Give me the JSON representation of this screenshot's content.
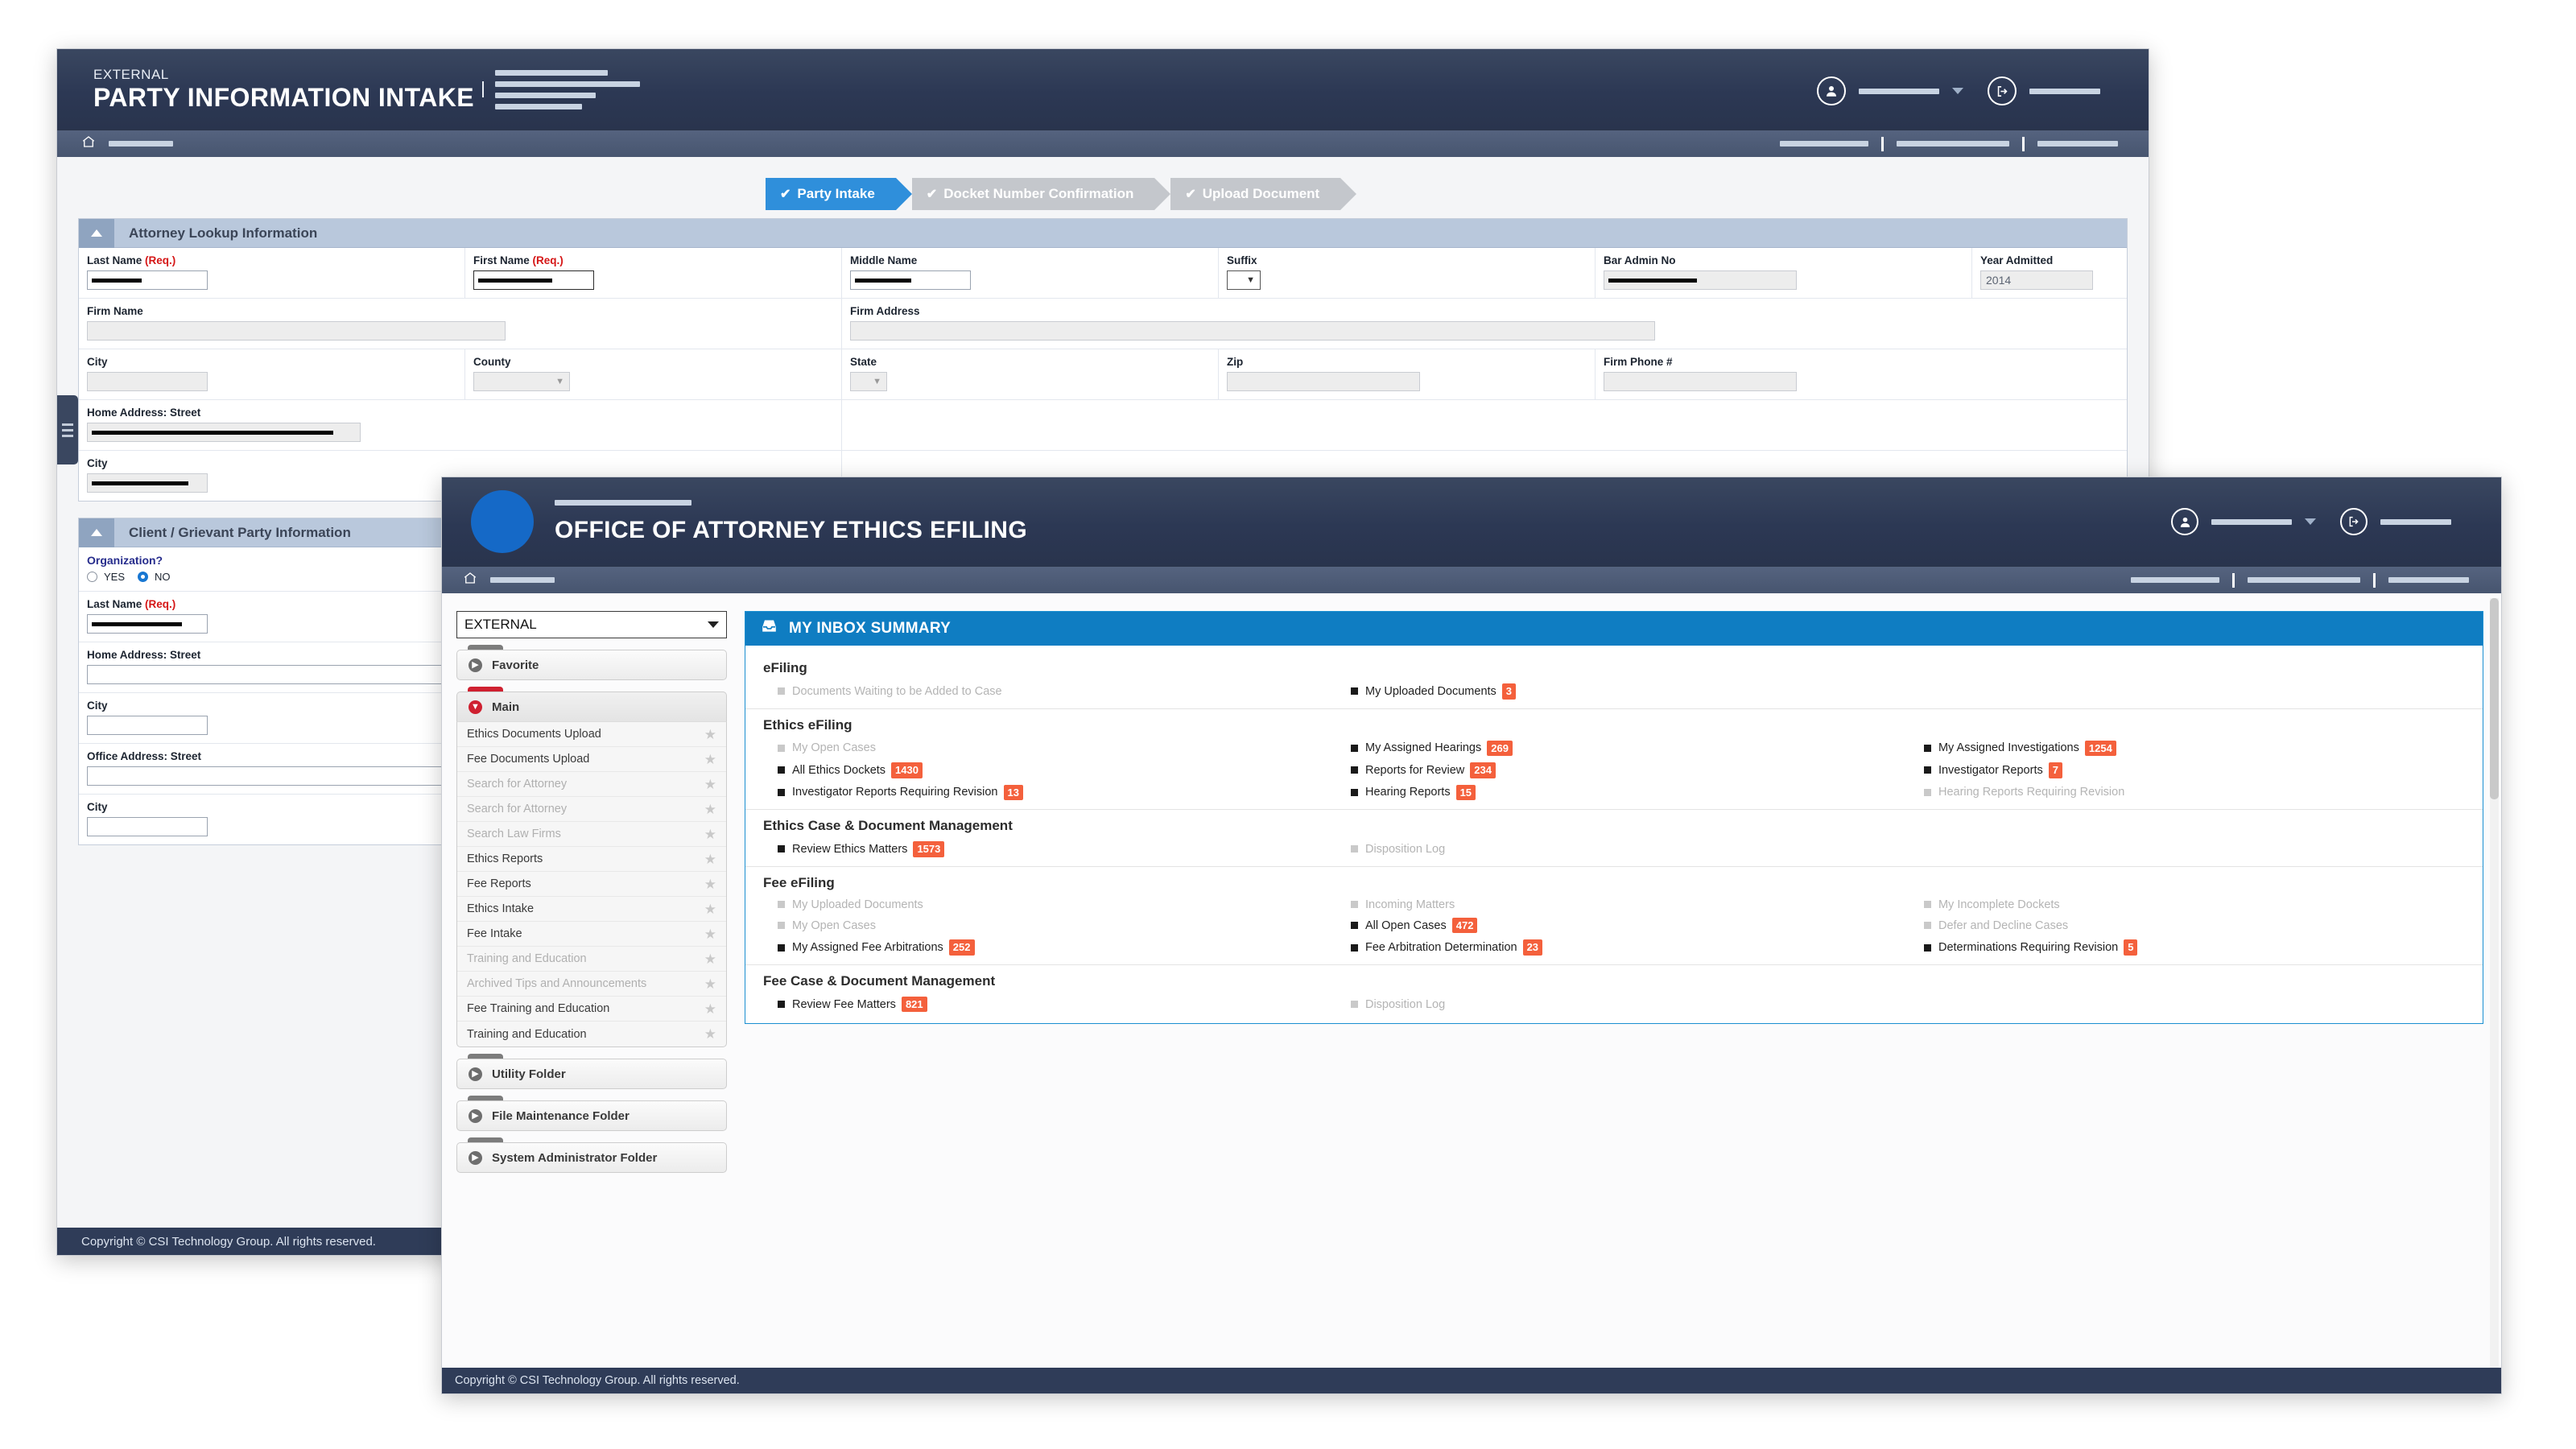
{
  "back_window": {
    "header": {
      "eyebrow": "EXTERNAL",
      "title": "PARTY INFORMATION INTAKE",
      "user_icon": "user-circle-icon",
      "logout_icon": "logout-icon"
    },
    "wizard": {
      "steps": [
        {
          "label": "Party Intake",
          "active": true,
          "check": "✔"
        },
        {
          "label": "Docket Number Confirmation",
          "active": false,
          "check": "✔"
        },
        {
          "label": "Upload Document",
          "active": false,
          "check": "✔"
        }
      ]
    },
    "panel_attorney": {
      "title": "Attorney Lookup Information",
      "fields": {
        "last_name": {
          "label": "Last Name",
          "req": "(Req.)",
          "value": "█████"
        },
        "first_name": {
          "label": "First Name",
          "req": "(Req.)",
          "value": "█████"
        },
        "middle_name": {
          "label": "Middle Name",
          "value": "████"
        },
        "suffix": {
          "label": "Suffix",
          "value": ""
        },
        "bar_admin_no": {
          "label": "Bar Admin No",
          "value": "████"
        },
        "year_admitted": {
          "label": "Year Admitted",
          "value": "2014"
        },
        "firm_name": {
          "label": "Firm Name",
          "value": ""
        },
        "firm_address": {
          "label": "Firm Address",
          "value": ""
        },
        "city": {
          "label": "City",
          "value": ""
        },
        "county": {
          "label": "County",
          "value": ""
        },
        "state": {
          "label": "State",
          "value": ""
        },
        "zip": {
          "label": "Zip",
          "value": ""
        },
        "firm_phone": {
          "label": "Firm Phone #",
          "value": ""
        },
        "home_street": {
          "label": "Home Address: Street",
          "value": "██████"
        },
        "home_city": {
          "label": "City",
          "value": "█████"
        }
      }
    },
    "panel_client": {
      "title": "Client / Grievant Party Information",
      "organization_question": "Organization?",
      "organization_options": [
        {
          "label": "YES",
          "selected": false
        },
        {
          "label": "NO",
          "selected": true
        }
      ],
      "fields": {
        "last_name": {
          "label": "Last Name",
          "req": "(Req.)",
          "value": "██████"
        },
        "home_street": {
          "label": "Home Address: Street",
          "value": ""
        },
        "home_city": {
          "label": "City",
          "value": ""
        },
        "office_street": {
          "label": "Office Address: Street",
          "value": ""
        },
        "office_city": {
          "label": "City",
          "value": ""
        }
      }
    },
    "footer": "Copyright © CSI Technology Group. All rights reserved."
  },
  "front_window": {
    "header": {
      "title": "OFFICE OF ATTORNEY ETHICS EFILING",
      "seal_icon": "agency-seal-icon",
      "user_icon": "user-circle-icon",
      "logout_icon": "logout-icon"
    },
    "sidebar": {
      "context_select": {
        "value": "EXTERNAL",
        "icon": "chevron-down-icon"
      },
      "folders": [
        {
          "title": "Favorite",
          "icon": "expand-circle-icon",
          "open": false,
          "accent": "gray",
          "items": []
        },
        {
          "title": "Main",
          "icon": "collapse-circle-icon",
          "open": true,
          "accent": "red",
          "items": [
            {
              "label": "Ethics Documents Upload",
              "dim": false
            },
            {
              "label": "Fee Documents Upload",
              "dim": false
            },
            {
              "label": "Search for Attorney",
              "dim": true
            },
            {
              "label": "Search for Attorney",
              "dim": true
            },
            {
              "label": "Search Law Firms",
              "dim": true
            },
            {
              "label": "Ethics Reports",
              "dim": false
            },
            {
              "label": "Fee Reports",
              "dim": false
            },
            {
              "label": "Ethics Intake",
              "dim": false
            },
            {
              "label": "Fee Intake",
              "dim": false
            },
            {
              "label": "Training and Education",
              "dim": true
            },
            {
              "label": "Archived Tips and Announcements",
              "dim": true
            },
            {
              "label": "Fee Training and Education",
              "dim": false
            },
            {
              "label": "Training and Education",
              "dim": false
            }
          ]
        },
        {
          "title": "Utility Folder",
          "icon": "expand-circle-icon",
          "open": false,
          "accent": "gray",
          "items": []
        },
        {
          "title": "File Maintenance Folder",
          "icon": "expand-circle-icon",
          "open": false,
          "accent": "gray",
          "items": []
        },
        {
          "title": "System Administrator Folder",
          "icon": "expand-circle-icon",
          "open": false,
          "accent": "gray",
          "items": []
        }
      ]
    },
    "inbox": {
      "title": "MY INBOX SUMMARY",
      "icon": "inbox-icon",
      "groups": [
        {
          "title": "eFiling",
          "rows": [
            [
              {
                "label": "Documents Waiting to be Added to Case",
                "count": null,
                "dim": true
              },
              {
                "label": "My Uploaded Documents",
                "count": "3",
                "dim": false
              },
              {
                "label": "",
                "count": null,
                "dim": true
              }
            ]
          ]
        },
        {
          "title": "Ethics eFiling",
          "rows": [
            [
              {
                "label": "My Open Cases",
                "count": null,
                "dim": true
              },
              {
                "label": "My Assigned Hearings",
                "count": "269",
                "dim": false
              },
              {
                "label": "My Assigned Investigations",
                "count": "1254",
                "dim": false
              }
            ],
            [
              {
                "label": "All Ethics Dockets",
                "count": "1430",
                "dim": false
              },
              {
                "label": "Reports for Review",
                "count": "234",
                "dim": false
              },
              {
                "label": "Investigator Reports",
                "count": "7",
                "dim": false
              }
            ],
            [
              {
                "label": "Investigator Reports Requiring Revision",
                "count": "13",
                "dim": false
              },
              {
                "label": "Hearing Reports",
                "count": "15",
                "dim": false
              },
              {
                "label": "Hearing Reports Requiring Revision",
                "count": null,
                "dim": true
              }
            ]
          ]
        },
        {
          "title": "Ethics Case & Document Management",
          "rows": [
            [
              {
                "label": "Review Ethics Matters",
                "count": "1573",
                "dim": false
              },
              {
                "label": "Disposition Log",
                "count": null,
                "dim": true
              },
              {
                "label": "",
                "count": null,
                "dim": true
              }
            ]
          ]
        },
        {
          "title": "Fee eFiling",
          "rows": [
            [
              {
                "label": "My Uploaded Documents",
                "count": null,
                "dim": true
              },
              {
                "label": "Incoming Matters",
                "count": null,
                "dim": true
              },
              {
                "label": "My Incomplete Dockets",
                "count": null,
                "dim": true
              }
            ],
            [
              {
                "label": "My Open Cases",
                "count": null,
                "dim": true
              },
              {
                "label": "All Open Cases",
                "count": "472",
                "dim": false
              },
              {
                "label": "Defer and Decline Cases",
                "count": null,
                "dim": true
              }
            ],
            [
              {
                "label": "My Assigned Fee Arbitrations",
                "count": "252",
                "dim": false
              },
              {
                "label": "Fee Arbitration Determination",
                "count": "23",
                "dim": false
              },
              {
                "label": "Determinations Requiring Revision",
                "count": "5",
                "dim": false
              }
            ]
          ]
        },
        {
          "title": "Fee Case & Document Management",
          "rows": [
            [
              {
                "label": "Review Fee Matters",
                "count": "821",
                "dim": false
              },
              {
                "label": "Disposition Log",
                "count": null,
                "dim": true
              },
              {
                "label": "",
                "count": null,
                "dim": true
              }
            ]
          ]
        }
      ]
    },
    "footer": "Copyright © CSI Technology Group. All rights reserved."
  },
  "colors": {
    "header_navy": "#2c3854",
    "breadcrumb_blue": "#47556f",
    "accent_blue": "#0f7dc2",
    "step_active": "#2f8fdb",
    "badge_orange": "#f4603c",
    "required_red": "#d51616",
    "folder_red": "#cf2030",
    "seal_blue": "#1569c7"
  }
}
